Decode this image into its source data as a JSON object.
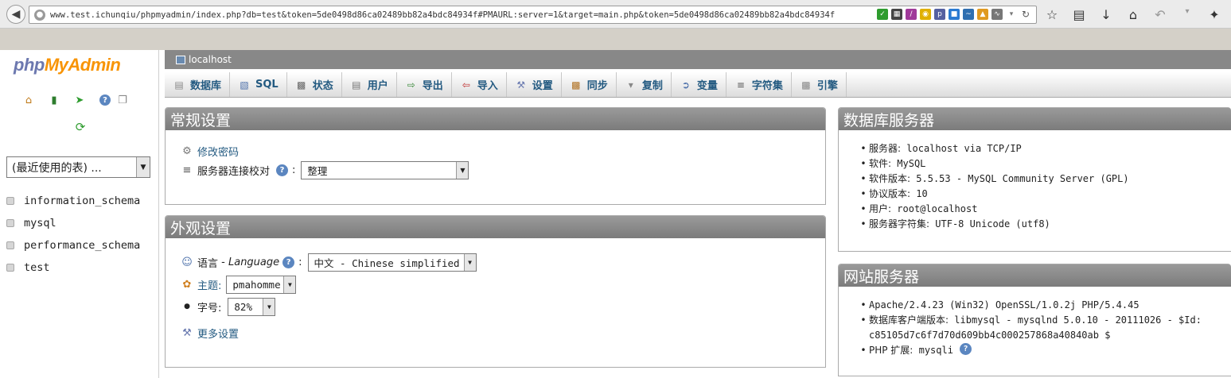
{
  "browser": {
    "url": "www.test.ichunqiu/phpmyadmin/index.php?db=test&token=5de0498d86ca02489bb82a4bdc84934f#PMAURL:server=1&target=main.php&token=5de0498d86ca02489bb82a4bdc84934f"
  },
  "logo": {
    "php": "php",
    "my": "My",
    "admin": "Admin"
  },
  "sidebar": {
    "recent_tables": "(最近使用的表) ...",
    "databases": [
      "information_schema",
      "mysql",
      "performance_schema",
      "test"
    ]
  },
  "server_bar": {
    "label": "localhost"
  },
  "tabs": [
    "数据库",
    "SQL",
    "状态",
    "用户",
    "导出",
    "导入",
    "设置",
    "同步",
    "复制",
    "变量",
    "字符集",
    "引擎"
  ],
  "general_settings": {
    "title": "常规设置",
    "change_password": "修改密码",
    "collation_label": "服务器连接校对",
    "collation_value": "整理"
  },
  "appearance_settings": {
    "title": "外观设置",
    "language_label": "语言",
    "language_label_en": "Language",
    "language_value": "中文 - Chinese simplified",
    "theme_label": "主题:",
    "theme_value": "pmahomme",
    "font_size_label": "字号:",
    "font_size_value": "82%",
    "more_settings": "更多设置"
  },
  "db_server": {
    "title": "数据库服务器",
    "items": [
      {
        "label": "服务器:",
        "value": "localhost via TCP/IP"
      },
      {
        "label": "软件:",
        "value": "MySQL"
      },
      {
        "label": "软件版本:",
        "value": "5.5.53 - MySQL Community Server (GPL)"
      },
      {
        "label": "协议版本:",
        "value": "10"
      },
      {
        "label": "用户:",
        "value": "root@localhost"
      },
      {
        "label": "服务器字符集:",
        "value": "UTF-8 Unicode (utf8)"
      }
    ]
  },
  "web_server": {
    "title": "网站服务器",
    "apache": "Apache/2.4.23 (Win32) OpenSSL/1.0.2j PHP/5.4.45",
    "client_label": "数据库客户端版本:",
    "client_value": "libmysql - mysqlnd 5.0.10 - 20111026 - $Id:",
    "client_value_2": "c85105d7c6f7d70d609bb4c000257868a40840ab $",
    "php_ext_label": "PHP 扩展:",
    "php_ext_value": "mysqli"
  }
}
